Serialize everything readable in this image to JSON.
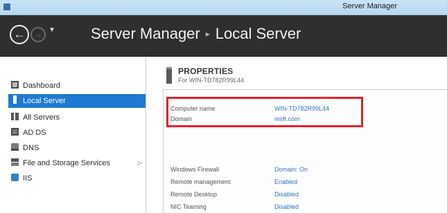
{
  "window": {
    "title": "Server Manager"
  },
  "header": {
    "breadcrumb": [
      "Server Manager",
      "Local Server"
    ],
    "separator": "▸"
  },
  "sidebar": {
    "items": [
      {
        "label": "Dashboard",
        "icon": "dashboard-icon",
        "selected": false
      },
      {
        "label": "Local Server",
        "icon": "local-server-icon",
        "selected": true
      },
      {
        "label": "All Servers",
        "icon": "all-servers-icon",
        "selected": false
      },
      {
        "label": "AD DS",
        "icon": "ad-ds-icon",
        "selected": false
      },
      {
        "label": "DNS",
        "icon": "dns-icon",
        "selected": false
      },
      {
        "label": "File and Storage Services",
        "icon": "file-storage-icon",
        "selected": false,
        "expander": "▷"
      },
      {
        "label": "IIS",
        "icon": "iis-icon",
        "selected": false
      }
    ]
  },
  "properties": {
    "title": "PROPERTIES",
    "subtitle": "For WIN-TD782R99L44",
    "highlighted": [
      {
        "key": "Computer name",
        "value": "WIN-TD782R99L44"
      },
      {
        "key": "Domain",
        "value": "msft.com"
      }
    ],
    "rows": [
      {
        "key": "Windows Firewall",
        "value": "Domain: On"
      },
      {
        "key": "Remote management",
        "value": "Enabled"
      },
      {
        "key": "Remote Desktop",
        "value": "Disabled"
      },
      {
        "key": "NIC Teaming",
        "value": "Disabled"
      }
    ]
  },
  "colors": {
    "accent": "#1f7ad2",
    "header_bg": "#2f2f2f",
    "link": "#2f73c0",
    "highlight_box": "#e5202a"
  }
}
